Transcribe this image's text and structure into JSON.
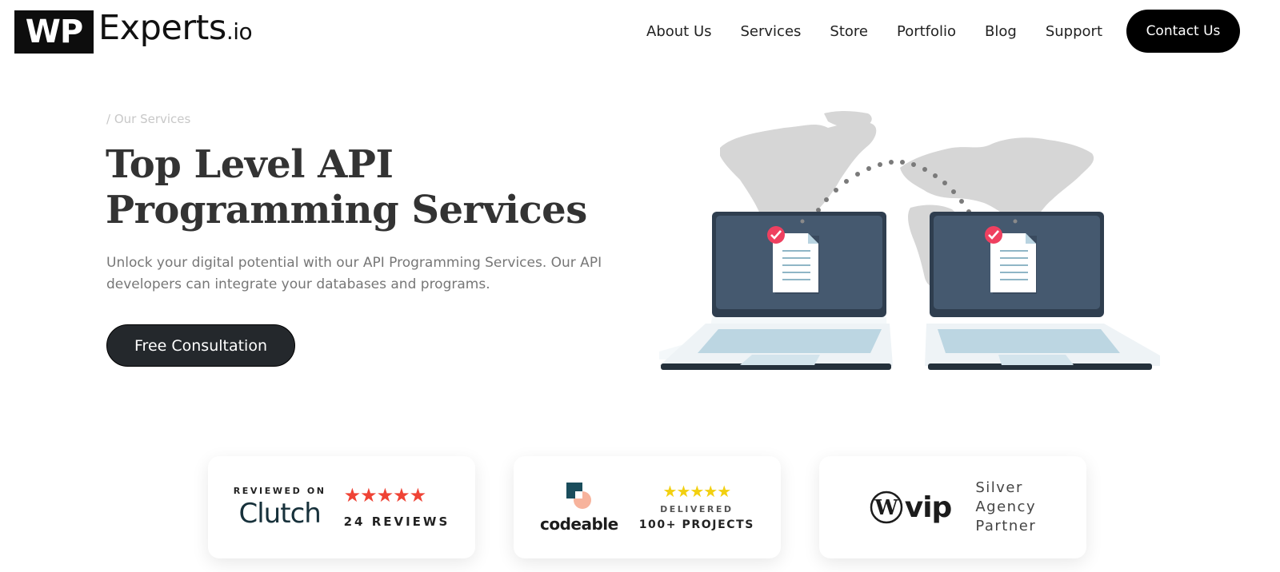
{
  "header": {
    "logo": {
      "box_text": "WP",
      "name": "Experts",
      "tld": ".io"
    },
    "nav": [
      {
        "label": "About Us"
      },
      {
        "label": "Services"
      },
      {
        "label": "Store"
      },
      {
        "label": "Portfolio"
      },
      {
        "label": "Blog"
      },
      {
        "label": "Support"
      }
    ],
    "contact_label": "Contact Us"
  },
  "hero": {
    "breadcrumb": "/ Our Services",
    "title": "Top Level API Programming Services",
    "description": "Unlock your digital potential with our API Programming Services. Our API developers can integrate your databases and programs.",
    "cta_label": "Free Consultation",
    "illustration": "two-laptops-world-map-document-transfer"
  },
  "badges": {
    "clutch": {
      "reviewed_on": "REVIEWED ON",
      "brand": "Clutch",
      "stars": "★★★★★",
      "rating": 5,
      "reviews": "24 REVIEWS",
      "star_color": "#ef4335"
    },
    "codeable": {
      "brand": "codeable",
      "stars": "★★★★★",
      "rating": 5,
      "delivered": "DELIVERED",
      "projects": "100+ PROJECTS",
      "star_color": "#f2d010"
    },
    "vip": {
      "brand": "vip",
      "line1": "Silver",
      "line2": "Agency",
      "line3": "Partner"
    }
  },
  "colors": {
    "primary_dark": "#000000",
    "cta_bg": "#24282c",
    "laptop_screen": "#45596f",
    "check_badge": "#ef4060"
  }
}
